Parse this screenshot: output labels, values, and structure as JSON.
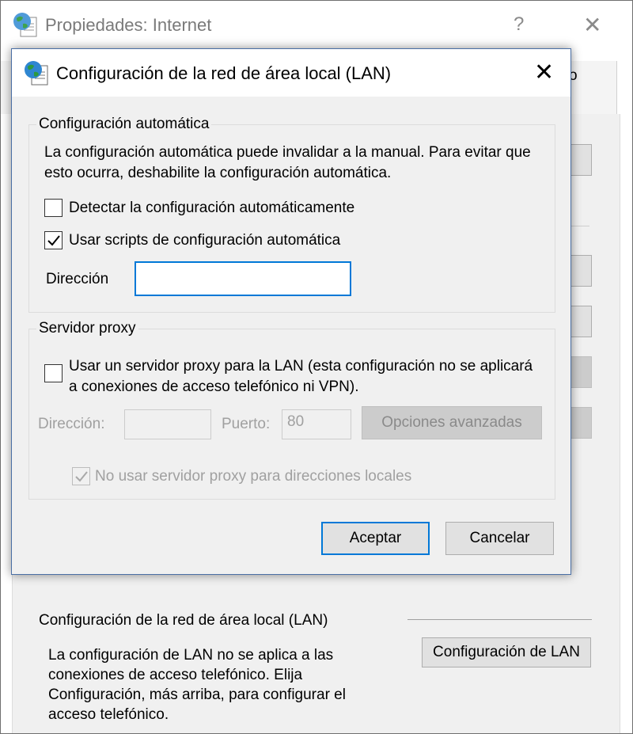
{
  "background_window": {
    "title": "Propiedades: Internet",
    "help_glyph": "?",
    "close_glyph": "✕",
    "tab_fragment": "o",
    "lan_section": {
      "title": "Configuración de la red de área local (LAN)",
      "description": "La configuración de LAN no se aplica a las conexiones de acceso telefónico. Elija Configuración, más arriba, para configurar el acceso telefónico.",
      "button_label": "Configuración de LAN"
    }
  },
  "dialog": {
    "title": "Configuración de la red de área local (LAN)",
    "close_glyph": "✕",
    "auto_config": {
      "group_label": "Configuración automática",
      "description": "La configuración automática puede invalidar a la manual. Para evitar que esto ocurra, deshabilite la configuración automática.",
      "detect_checkbox": {
        "label": "Detectar la configuración automáticamente",
        "checked": false
      },
      "scripts_checkbox": {
        "label": "Usar scripts de configuración automática",
        "checked": true
      },
      "address_label": "Dirección",
      "address_value": ""
    },
    "proxy": {
      "group_label": "Servidor proxy",
      "use_proxy_checkbox": {
        "label": "Usar un servidor proxy para la LAN (esta configuración no se aplicará a conexiones de acceso telefónico ni VPN).",
        "checked": false
      },
      "address_label": "Dirección:",
      "address_value": "",
      "port_label": "Puerto:",
      "port_value": "80",
      "advanced_button": "Opciones avanzadas",
      "bypass_local_checkbox": {
        "label": "No usar servidor proxy para direcciones locales",
        "checked": true,
        "enabled": false
      }
    },
    "buttons": {
      "ok": "Aceptar",
      "cancel": "Cancelar"
    }
  },
  "icons": {
    "window_icon": "globe-document-icon",
    "check": "checkmark-icon"
  },
  "colors": {
    "accent": "#0078d7",
    "dialog_bg": "#f0f0f0",
    "disabled_text": "#a0a0a0"
  }
}
